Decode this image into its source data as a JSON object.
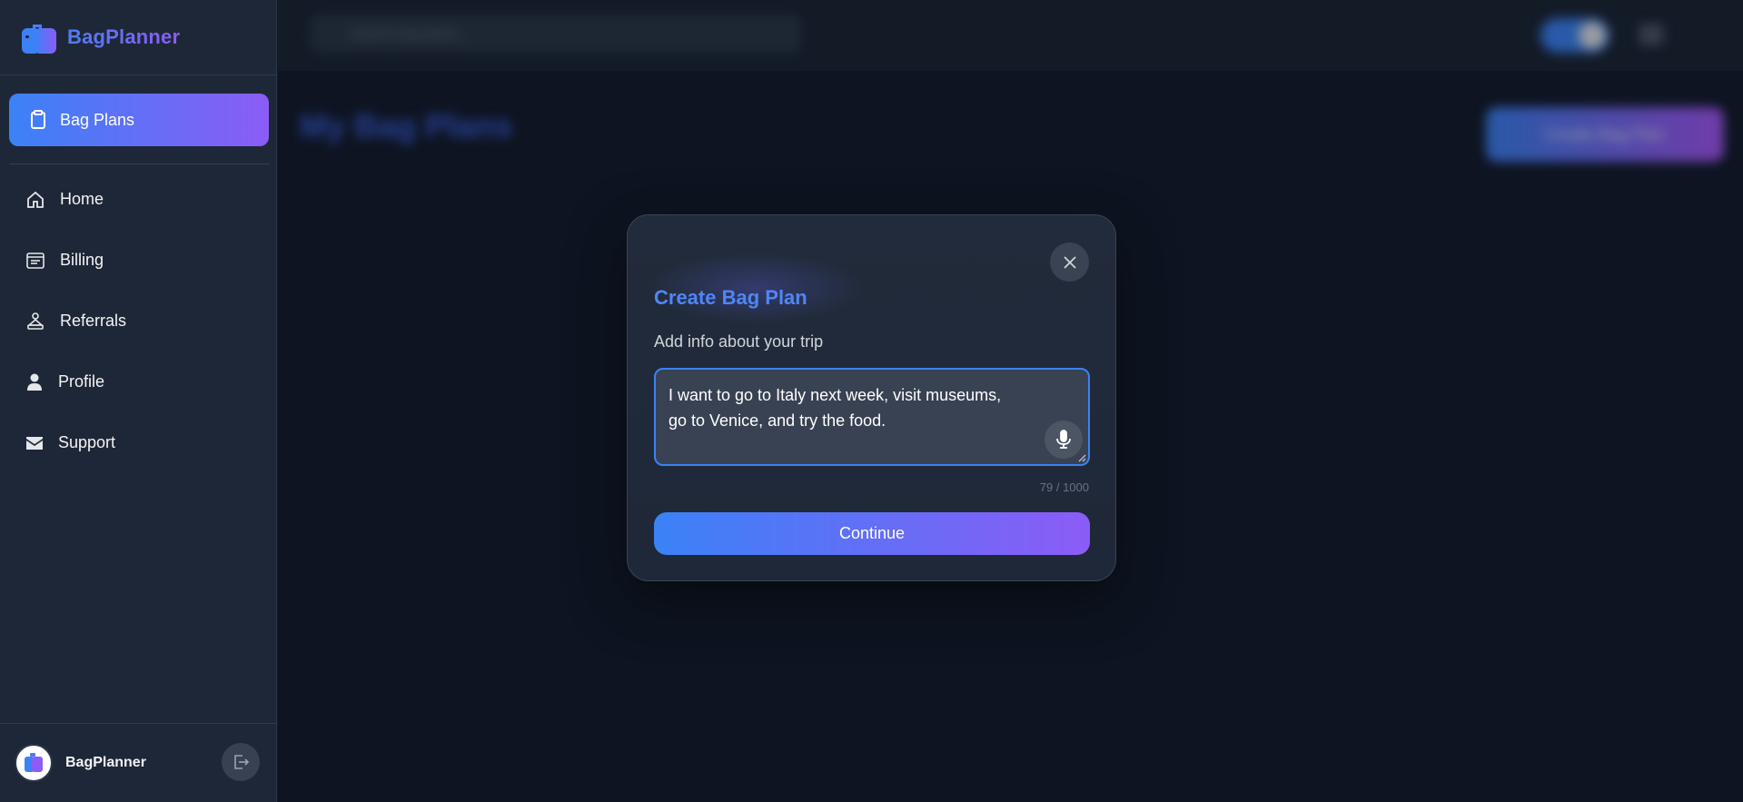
{
  "brand": {
    "name": "BagPlanner",
    "logo_icon": "suitcase-icon"
  },
  "sidebar": {
    "active_item": {
      "label": "Bag Plans",
      "icon": "clipboard-icon"
    },
    "items": [
      {
        "label": "Home",
        "icon": "home-icon"
      },
      {
        "label": "Billing",
        "icon": "billing-icon"
      },
      {
        "label": "Referrals",
        "icon": "referrals-icon"
      },
      {
        "label": "Profile",
        "icon": "user-icon"
      },
      {
        "label": "Support",
        "icon": "mail-icon"
      }
    ],
    "footer": {
      "name": "BagPlanner",
      "logout_icon": "logout-icon"
    }
  },
  "background": {
    "search_placeholder": "Search bag plans...",
    "page_title": "My Bag Plans",
    "cta_label": "Create Bag Plan"
  },
  "modal": {
    "title": "Create Bag Plan",
    "subtitle": "Add info about your trip",
    "trip_text": "I want to go to Italy next week, visit museums,\ngo to Venice, and try the food.",
    "char_count": "79 / 1000",
    "continue_label": "Continue"
  },
  "colors": {
    "accent_start": "#3b82f6",
    "accent_end": "#8b5cf6",
    "background": "#111827",
    "sidebar": "#1e2737"
  }
}
